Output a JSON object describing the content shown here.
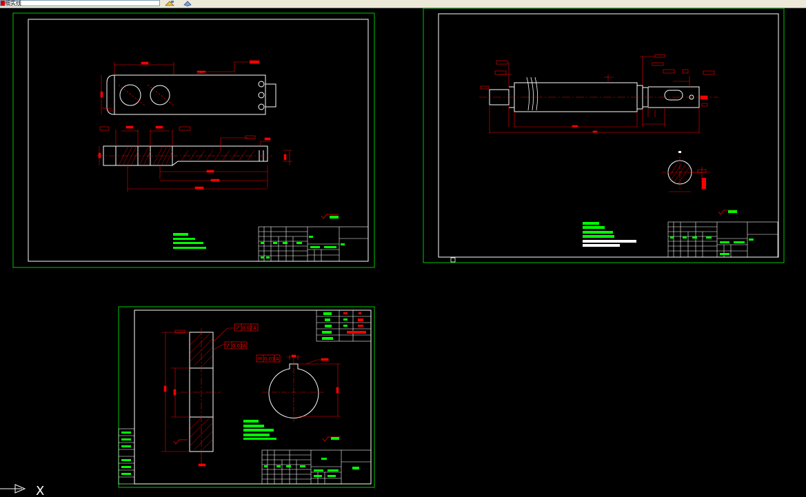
{
  "toolbar": {
    "layer_value": "细实线",
    "layer_color": "#cc0000"
  },
  "colors": {
    "background": "#000000",
    "sheet_border": "#00c800",
    "drawing_line": "#ffffff",
    "dimension": "#ff0000",
    "text_highlight": "#00ff00"
  },
  "drawing_1": {
    "datum_label_1": "A",
    "datum_label_2": "A",
    "datum_label_3": "A",
    "tolerance_1": "0.02",
    "tolerance_2": "0.02",
    "tolerance_3": "0.03"
  },
  "ucs": {
    "x_label": "X"
  }
}
